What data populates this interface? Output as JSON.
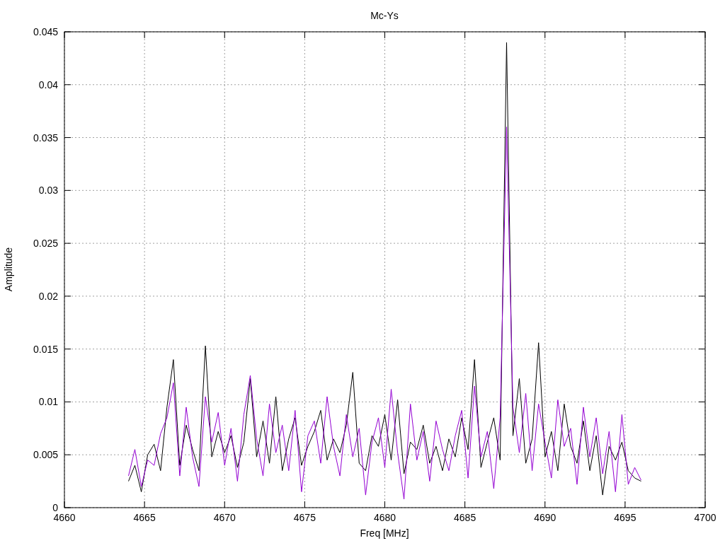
{
  "chart_data": {
    "type": "line",
    "title": "Mc-Ys",
    "xlabel": "Freq [MHz]",
    "ylabel": "Amplitude",
    "grid": true,
    "xlim": [
      4660,
      4700
    ],
    "ylim": [
      0,
      0.045
    ],
    "xticks": [
      4660,
      4665,
      4670,
      4675,
      4680,
      4685,
      4690,
      4695,
      4700
    ],
    "yticks": [
      0,
      0.005,
      0.01,
      0.015,
      0.02,
      0.025,
      0.03,
      0.035,
      0.04,
      0.045
    ],
    "x": [
      4664.0,
      4664.4,
      4664.8,
      4665.2,
      4665.6,
      4666.0,
      4666.4,
      4666.8,
      4667.2,
      4667.6,
      4668.0,
      4668.4,
      4668.8,
      4669.2,
      4669.6,
      4670.0,
      4670.4,
      4670.8,
      4671.2,
      4671.6,
      4672.0,
      4672.4,
      4672.8,
      4673.2,
      4673.6,
      4674.0,
      4674.4,
      4674.8,
      4675.2,
      4675.6,
      4676.0,
      4676.4,
      4676.8,
      4677.2,
      4677.6,
      4678.0,
      4678.4,
      4678.8,
      4679.2,
      4679.6,
      4680.0,
      4680.4,
      4680.8,
      4681.2,
      4681.6,
      4682.0,
      4682.4,
      4682.8,
      4683.2,
      4683.6,
      4684.0,
      4684.4,
      4684.8,
      4685.2,
      4685.6,
      4686.0,
      4686.4,
      4686.8,
      4687.2,
      4687.6,
      4688.0,
      4688.4,
      4688.8,
      4689.2,
      4689.6,
      4690.0,
      4690.4,
      4690.8,
      4691.2,
      4691.6,
      4692.0,
      4692.4,
      4692.8,
      4693.2,
      4693.6,
      4694.0,
      4694.4,
      4694.8,
      4695.2,
      4695.6,
      4696.0
    ],
    "series": [
      {
        "color": "#000000",
        "values": [
          0.0025,
          0.004,
          0.0015,
          0.005,
          0.006,
          0.0035,
          0.0095,
          0.014,
          0.004,
          0.0078,
          0.0055,
          0.0035,
          0.0153,
          0.0048,
          0.0072,
          0.0052,
          0.0068,
          0.0038,
          0.0062,
          0.0122,
          0.0048,
          0.0082,
          0.0042,
          0.0105,
          0.0035,
          0.0065,
          0.0085,
          0.004,
          0.0058,
          0.0072,
          0.0092,
          0.0045,
          0.0065,
          0.0052,
          0.0078,
          0.0128,
          0.0042,
          0.0035,
          0.0068,
          0.0058,
          0.0088,
          0.0045,
          0.0102,
          0.0032,
          0.0062,
          0.0055,
          0.0078,
          0.0042,
          0.0058,
          0.0035,
          0.0065,
          0.0048,
          0.0085,
          0.0055,
          0.014,
          0.0038,
          0.0062,
          0.0085,
          0.0045,
          0.044,
          0.0068,
          0.0122,
          0.0042,
          0.0065,
          0.0156,
          0.0048,
          0.0072,
          0.0035,
          0.0098,
          0.0058,
          0.0042,
          0.0082,
          0.0035,
          0.0068,
          0.0012,
          0.0058,
          0.0045,
          0.0062,
          0.0035,
          0.0028,
          0.0025
        ]
      },
      {
        "color": "#9400d3",
        "values": [
          0.003,
          0.0055,
          0.002,
          0.0045,
          0.004,
          0.007,
          0.0085,
          0.0118,
          0.003,
          0.0095,
          0.0048,
          0.002,
          0.0105,
          0.0062,
          0.009,
          0.004,
          0.0075,
          0.0025,
          0.0088,
          0.0125,
          0.0065,
          0.003,
          0.0098,
          0.0052,
          0.0078,
          0.0035,
          0.0092,
          0.0015,
          0.0068,
          0.0082,
          0.0042,
          0.0105,
          0.0058,
          0.003,
          0.0088,
          0.0048,
          0.0075,
          0.0012,
          0.0062,
          0.0085,
          0.0038,
          0.0112,
          0.0052,
          0.0008,
          0.0098,
          0.0045,
          0.0072,
          0.0025,
          0.0082,
          0.0055,
          0.0035,
          0.0068,
          0.0092,
          0.0028,
          0.0115,
          0.0048,
          0.0072,
          0.0018,
          0.0085,
          0.036,
          0.0095,
          0.0052,
          0.0108,
          0.0035,
          0.0098,
          0.0062,
          0.0028,
          0.0102,
          0.0058,
          0.0075,
          0.0022,
          0.0095,
          0.0048,
          0.0085,
          0.0032,
          0.0072,
          0.0015,
          0.0088,
          0.0022,
          0.0038,
          0.0026
        ]
      }
    ]
  }
}
